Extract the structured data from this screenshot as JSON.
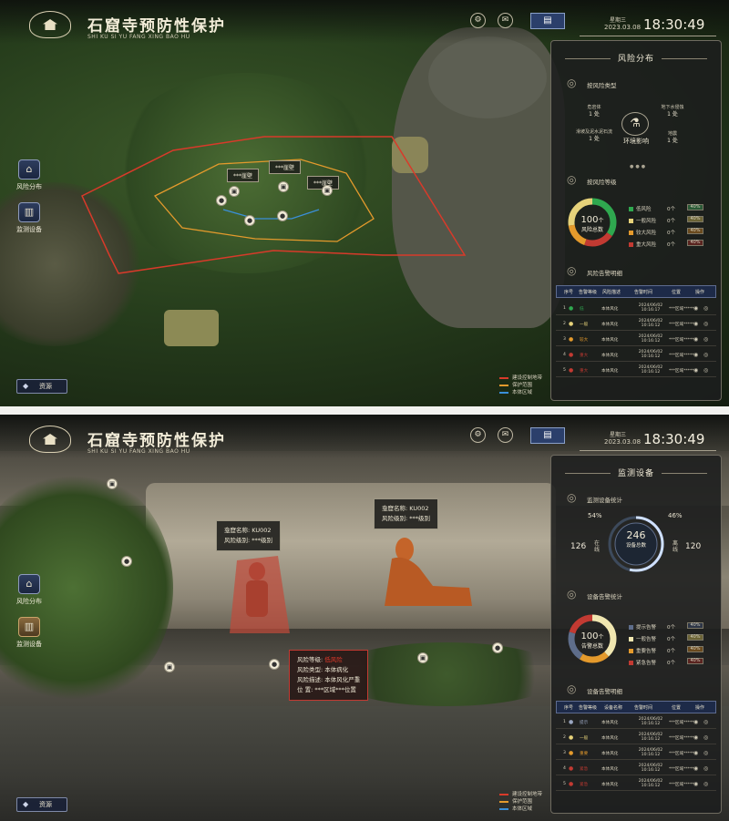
{
  "app": {
    "title": "石窟寺预防性保护",
    "subtitle": "SHI KU SI YU FANG XING BAO HU"
  },
  "datetime": {
    "weekday": "星期三",
    "date": "2023.03.08",
    "time": "18:30:49"
  },
  "nav": [
    {
      "label": "风险分布",
      "icon": "temple-icon"
    },
    {
      "label": "监测设备",
      "icon": "device-icon"
    }
  ],
  "resource_button": "资源",
  "map_legend": [
    {
      "label": "建设控制地带",
      "color": "#d83a2a"
    },
    {
      "label": "保护范围",
      "color": "#e49a2c"
    },
    {
      "label": "本体区域",
      "color": "#3a8fd8"
    }
  ],
  "screen1": {
    "map_tags": [
      "***崖壁",
      "***崖壁",
      "***崖壁"
    ],
    "panel_title": "风险分布",
    "risk_type_title": "按风险类型",
    "risk_types": [
      {
        "name": "危岩体",
        "count": "1 处"
      },
      {
        "name": "地下水侵蚀",
        "count": "1 处"
      },
      {
        "name": "滑坡及泥水泥石流",
        "count": "1 处"
      },
      {
        "name": "地震",
        "count": "1 处"
      }
    ],
    "env_label": "环境影响",
    "risk_level_title": "按风险等级",
    "donut": {
      "value": "100",
      "unit": "个",
      "label": "风险总数"
    },
    "levels": [
      {
        "name": "低风险",
        "count": "0个",
        "pct": "40%",
        "color": "#2fa84f"
      },
      {
        "name": "一般风险",
        "count": "0个",
        "pct": "40%",
        "color": "#e6d27a"
      },
      {
        "name": "较大风险",
        "count": "0个",
        "pct": "40%",
        "color": "#e49a2c"
      },
      {
        "name": "重大风险",
        "count": "0个",
        "pct": "40%",
        "color": "#c23a32"
      }
    ],
    "table_title": "风险告警明细",
    "table_headers": [
      "序号",
      "告警等级",
      "风险描述",
      "告警时间",
      "位置",
      "操作"
    ],
    "rows": [
      {
        "no": "1",
        "level": "低",
        "level_color": "#2fa84f",
        "desc": "本体风化",
        "time": "2024/06/02 10:16:17",
        "loc": "***区域*****"
      },
      {
        "no": "2",
        "level": "一般",
        "level_color": "#e6d27a",
        "desc": "本体风化",
        "time": "2024/06/02 10:16:12",
        "loc": "***区域*****"
      },
      {
        "no": "3",
        "level": "较大",
        "level_color": "#e49a2c",
        "desc": "本体风化",
        "time": "2024/06/02 10:16:12",
        "loc": "***区域*****"
      },
      {
        "no": "4",
        "level": "重大",
        "level_color": "#c23a32",
        "desc": "本体风化",
        "time": "2024/06/02 10:16:12",
        "loc": "***区域*****"
      },
      {
        "no": "5",
        "level": "重大",
        "level_color": "#c23a32",
        "desc": "本体风化",
        "time": "2024/06/02 10:16:12",
        "loc": "***区域*****"
      }
    ]
  },
  "screen2": {
    "card1": {
      "line1": "龛窟名称:      KU002",
      "line2": "风险级别: ***级别"
    },
    "card2": {
      "line1": "龛窟名称:      KU002",
      "line2": "风险级别: ***级别"
    },
    "card3": {
      "l1_label": "风险等级:",
      "l1_value": "低风险",
      "l2": "风险类型: 本体病化",
      "l3": "风险描述: 本体风化严重",
      "l4": "位      置: ***区域***位置"
    },
    "panel_title": "监测设备",
    "stat_title": "监测设备统计",
    "gauge": {
      "total": "246",
      "label": "设备总数",
      "left_pct": "54%",
      "right_pct": "46%",
      "online": "126",
      "online_label": "在线",
      "offline": "120",
      "offline_label": "离线"
    },
    "alarm_stat_title": "设备告警统计",
    "donut": {
      "value": "100",
      "unit": "个",
      "label": "告警总数"
    },
    "levels": [
      {
        "name": "提示告警",
        "count": "0个",
        "pct": "40%",
        "color": "#5e6d8a"
      },
      {
        "name": "一般告警",
        "count": "0个",
        "pct": "40%",
        "color": "#f0e6b0"
      },
      {
        "name": "重要告警",
        "count": "0个",
        "pct": "40%",
        "color": "#e49a2c"
      },
      {
        "name": "紧急告警",
        "count": "0个",
        "pct": "40%",
        "color": "#c23a32"
      }
    ],
    "table_title": "设备告警明细",
    "table_headers": [
      "序号",
      "告警等级",
      "设备名称",
      "告警时间",
      "位置",
      "操作"
    ],
    "rows": [
      {
        "no": "1",
        "level": "提示",
        "level_color": "#9aa6c0",
        "desc": "本体风化",
        "time": "2024/06/02 10:16:12",
        "loc": "***区域*****"
      },
      {
        "no": "2",
        "level": "一般",
        "level_color": "#e6d27a",
        "desc": "本体风化",
        "time": "2024/06/02 10:16:12",
        "loc": "***区域*****"
      },
      {
        "no": "3",
        "level": "重要",
        "level_color": "#e49a2c",
        "desc": "本体风化",
        "time": "2024/06/02 10:16:12",
        "loc": "***区域*****"
      },
      {
        "no": "4",
        "level": "紧急",
        "level_color": "#c23a32",
        "desc": "本体风化",
        "time": "2024/06/02 10:16:12",
        "loc": "***区域*****"
      },
      {
        "no": "5",
        "level": "紧急",
        "level_color": "#c23a32",
        "desc": "本体风化",
        "time": "2024/06/02 10:16:12",
        "loc": "***区域*****"
      }
    ]
  }
}
